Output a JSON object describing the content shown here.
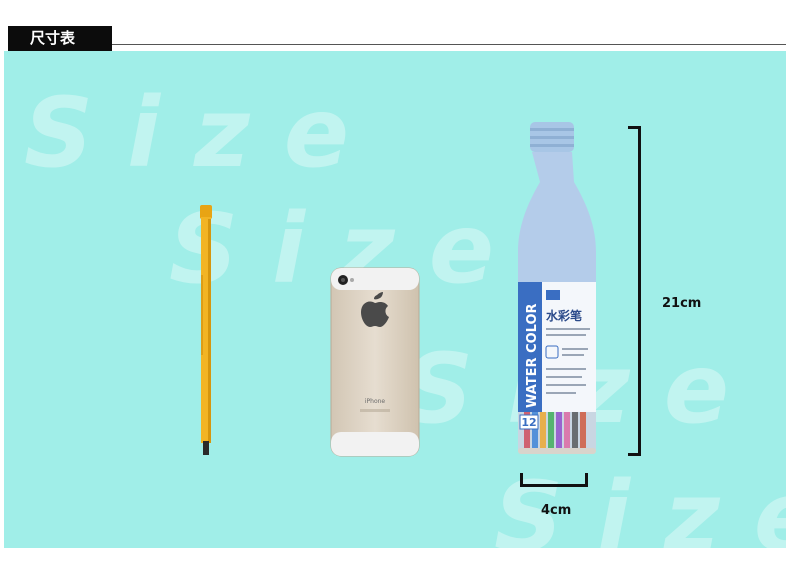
{
  "header": {
    "title": "尺寸表"
  },
  "watermark": {
    "text": "Size"
  },
  "dimensions": {
    "height_label": "21cm",
    "width_label": "4cm"
  },
  "phone": {
    "brand_text": "iPhone"
  },
  "bottle": {
    "vertical_text": "WATER COLOR",
    "cn_label": "水彩笔",
    "count": "12"
  },
  "colors": {
    "background": "#a0eee8",
    "tab": "#0c0c0c",
    "pen": "#f0b020",
    "bottle_cap": "#a8c6e6"
  }
}
